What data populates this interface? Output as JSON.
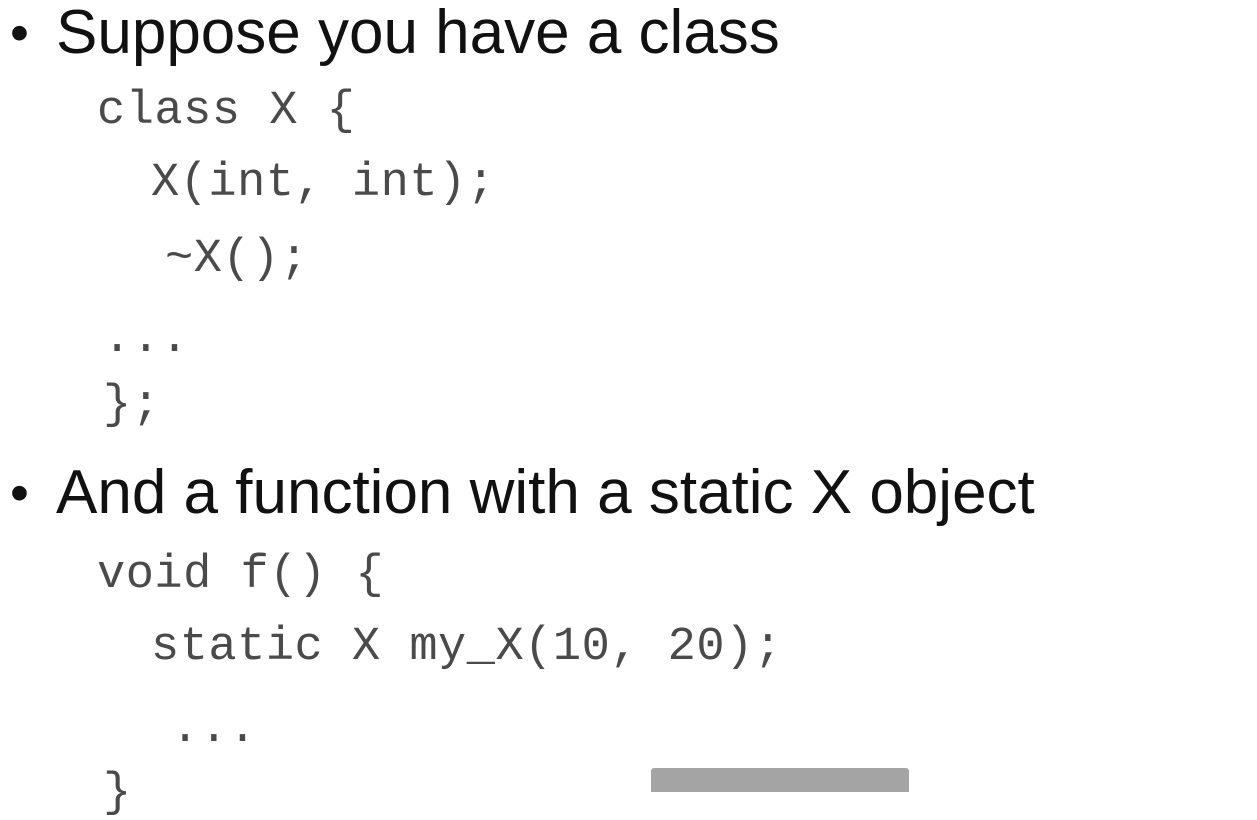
{
  "slide": {
    "bullets": [
      {
        "marker": "•",
        "text": "Suppose you have a class"
      },
      {
        "marker": "•",
        "text": "And a function with a static X object"
      }
    ],
    "code_blocks": [
      {
        "lines": [
          "class X {",
          "X(int, int);",
          "~X();",
          "...",
          "};"
        ]
      },
      {
        "lines": [
          "void f() {",
          "static X my_X(10, 20);",
          "...",
          "}"
        ]
      }
    ]
  }
}
